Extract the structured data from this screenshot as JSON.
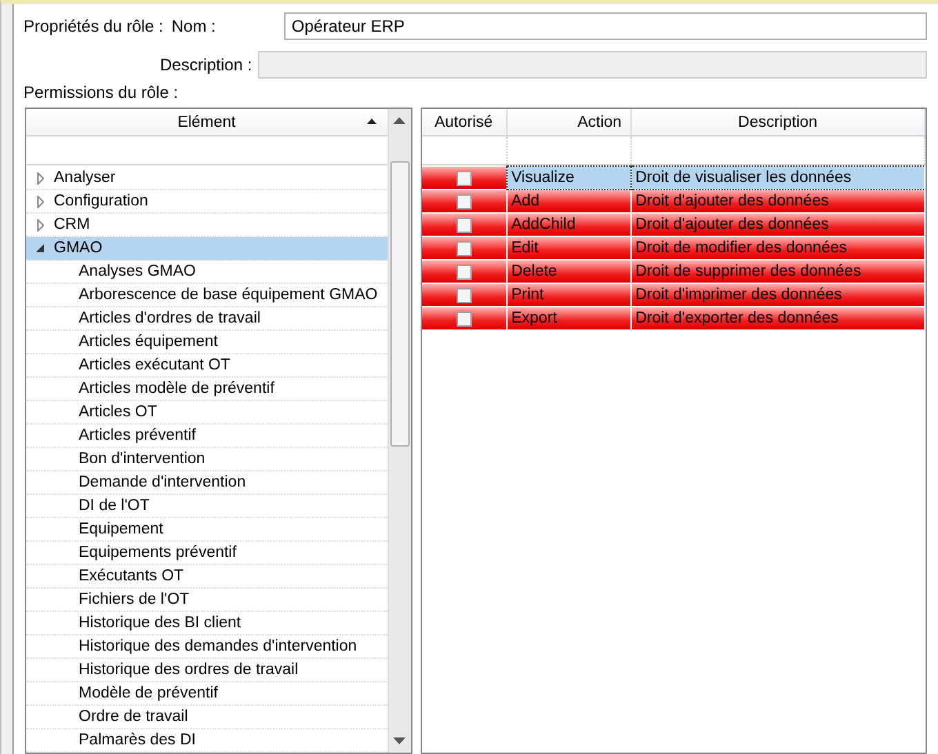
{
  "role_properties": {
    "label": "Propriétés du rôle :",
    "name_label": "Nom :",
    "name_value": "Opérateur ERP",
    "description_label": "Description :"
  },
  "permissions_label": "Permissions du rôle :",
  "element_tree": {
    "column": "Elément",
    "items": [
      {
        "label": "Analyser",
        "expanded": false,
        "selected": false
      },
      {
        "label": "Configuration",
        "expanded": false,
        "selected": false
      },
      {
        "label": "CRM",
        "expanded": false,
        "selected": false
      },
      {
        "label": "GMAO",
        "expanded": true,
        "selected": true,
        "children": [
          {
            "label": "Analyses GMAO"
          },
          {
            "label": "Arborescence de base équipement GMAO"
          },
          {
            "label": "Articles d'ordres de travail"
          },
          {
            "label": "Articles équipement"
          },
          {
            "label": "Articles exécutant OT"
          },
          {
            "label": "Articles modèle de préventif"
          },
          {
            "label": "Articles OT"
          },
          {
            "label": "Articles préventif"
          },
          {
            "label": "Bon d'intervention"
          },
          {
            "label": "Demande d'intervention"
          },
          {
            "label": "DI de l'OT"
          },
          {
            "label": "Equipement"
          },
          {
            "label": "Equipements préventif"
          },
          {
            "label": "Exécutants OT"
          },
          {
            "label": "Fichiers de l'OT"
          },
          {
            "label": "Historique des BI client"
          },
          {
            "label": "Historique des demandes d'intervention"
          },
          {
            "label": "Historique des ordres de travail"
          },
          {
            "label": "Modèle de préventif"
          },
          {
            "label": "Ordre de travail"
          },
          {
            "label": "Palmarès des DI"
          }
        ]
      }
    ]
  },
  "permissions_table": {
    "columns": [
      "Autorisé",
      "Action",
      "Description"
    ],
    "rows": [
      {
        "checked": false,
        "action": "Visualize",
        "description": "Droit de visualiser les données",
        "selected": true
      },
      {
        "checked": false,
        "action": "Add",
        "description": "Droit d'ajouter des données",
        "selected": false
      },
      {
        "checked": false,
        "action": "AddChild",
        "description": "Droit d'ajouter des données",
        "selected": false
      },
      {
        "checked": false,
        "action": "Edit",
        "description": "Droit de modifier des données",
        "selected": false
      },
      {
        "checked": false,
        "action": "Delete",
        "description": "Droit de supprimer des données",
        "selected": false
      },
      {
        "checked": false,
        "action": "Print",
        "description": "Droit d'imprimer des données",
        "selected": false
      },
      {
        "checked": false,
        "action": "Export",
        "description": "Droit d'exporter des données",
        "selected": false
      }
    ]
  }
}
